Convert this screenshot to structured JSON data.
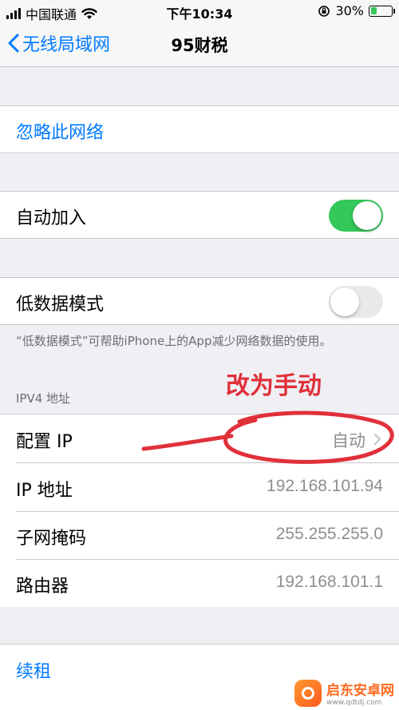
{
  "status_bar": {
    "carrier": "中国联通",
    "time": "下午10:34",
    "battery": "30%",
    "battery_level": 0.3
  },
  "nav": {
    "back_label": "无线局域网",
    "title": "95财税"
  },
  "forget_network": {
    "label": "忽略此网络"
  },
  "auto_join": {
    "label": "自动加入",
    "on": true
  },
  "low_data": {
    "label": "低数据模式",
    "on": false,
    "footnote": "“低数据模式”可帮助iPhone上的App减少网络数据的使用。"
  },
  "ipv4": {
    "header": "IPV4 地址",
    "rows": [
      {
        "label": "配置 IP",
        "value": "自动"
      },
      {
        "label": "IP 地址",
        "value": "192.168.101.94"
      },
      {
        "label": "子网掩码",
        "value": "255.255.255.0"
      },
      {
        "label": "路由器",
        "value": "192.168.101.1"
      }
    ]
  },
  "renew": {
    "label": "续租"
  },
  "annotation": {
    "text": "改为手动"
  },
  "watermark": {
    "name": "启东安卓网",
    "url": "www.qdtdj.com"
  },
  "colors": {
    "accent": "#007aff",
    "toggle_on": "#34c759",
    "annotation": "#e0303a"
  }
}
